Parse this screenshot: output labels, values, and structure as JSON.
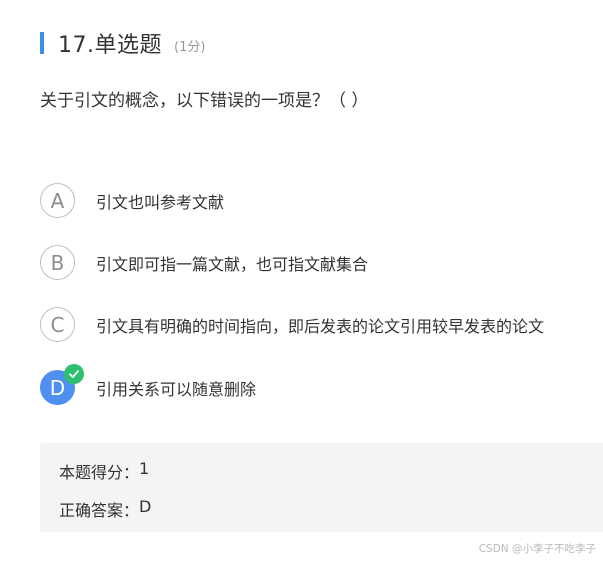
{
  "question": {
    "title": "17.单选题",
    "score": "(1分)",
    "text": "关于引文的概念，以下错误的一项是？（  ）"
  },
  "options": [
    {
      "letter": "A",
      "text": "引文也叫参考文献",
      "selected": false
    },
    {
      "letter": "B",
      "text": "引文即可指一篇文献，也可指文献集合",
      "selected": false
    },
    {
      "letter": "C",
      "text": "引文具有明确的时间指向，即后发表的论文引用较早发表的论文",
      "selected": false
    },
    {
      "letter": "D",
      "text": "引用关系可以随意删除",
      "selected": true
    }
  ],
  "result": {
    "score_label": "本题得分：",
    "score_value": "1",
    "answer_label": "正确答案：",
    "answer_value": "D"
  },
  "watermark": "CSDN @小李子不吃李子",
  "colors": {
    "accent": "#3a8ee6",
    "selected": "#4f8ff0",
    "correct": "#2fbf71",
    "panel": "#f4f4f4"
  },
  "icons": {
    "correct": "check-icon"
  }
}
